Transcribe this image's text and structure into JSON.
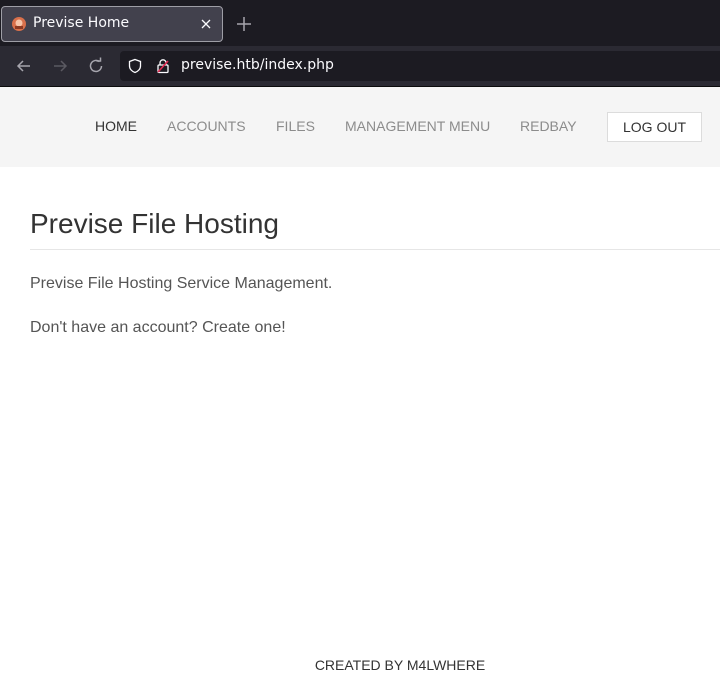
{
  "browser": {
    "tab": {
      "title": "Previse Home",
      "favicon": "previse-favicon-icon"
    },
    "url": "previse.htb/index.php"
  },
  "nav": {
    "items": [
      {
        "label": "HOME",
        "active": true
      },
      {
        "label": "ACCOUNTS",
        "active": false
      },
      {
        "label": "FILES",
        "active": false
      },
      {
        "label": "MANAGEMENT MENU",
        "active": false
      },
      {
        "label": "REDBAY",
        "active": false
      }
    ],
    "logout_label": "LOG OUT"
  },
  "main": {
    "title": "Previse File Hosting",
    "description": "Previse File Hosting Service Management.",
    "signup_prompt": "Don't have an account? Create one!"
  },
  "footer": {
    "text": "CREATED BY M4LWHERE"
  },
  "colors": {
    "chrome_dark": "#1c1b22",
    "chrome_toolbar": "#2b2a33",
    "nav_bg": "#f5f5f5",
    "text_primary": "#333333",
    "text_muted": "#8c8c8c"
  }
}
